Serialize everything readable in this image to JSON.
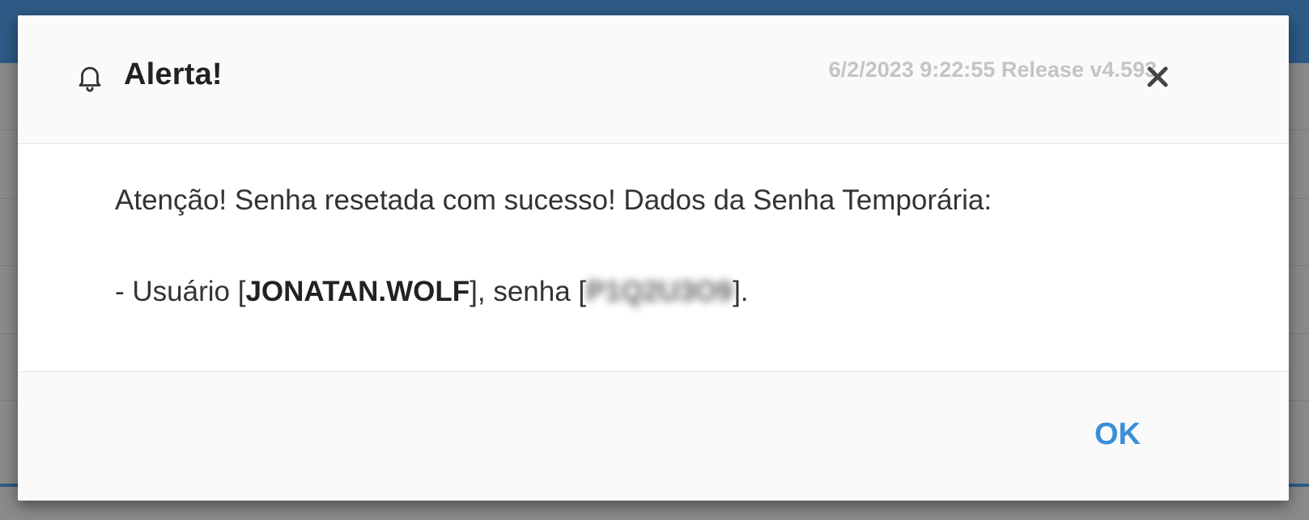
{
  "dialog": {
    "title": "Alerta!",
    "release_info": "6/2/2023 9:22:55 Release v4.593",
    "message_line1": "Atenção! Senha resetada com sucesso! Dados da Senha Temporária:",
    "user_prefix": "- Usuário [",
    "username": "JONATAN.WOLF",
    "password_prefix": "], senha [",
    "password_redacted": "P1Q2U3O9",
    "password_suffix": "].",
    "ok_label": "OK"
  },
  "icons": {
    "title_icon": "bell-icon",
    "close_icon": "close-icon"
  },
  "colors": {
    "topbar": "#2d5a85",
    "ok_accent": "#3b8fd9",
    "release_text": "#c4c4c4"
  }
}
